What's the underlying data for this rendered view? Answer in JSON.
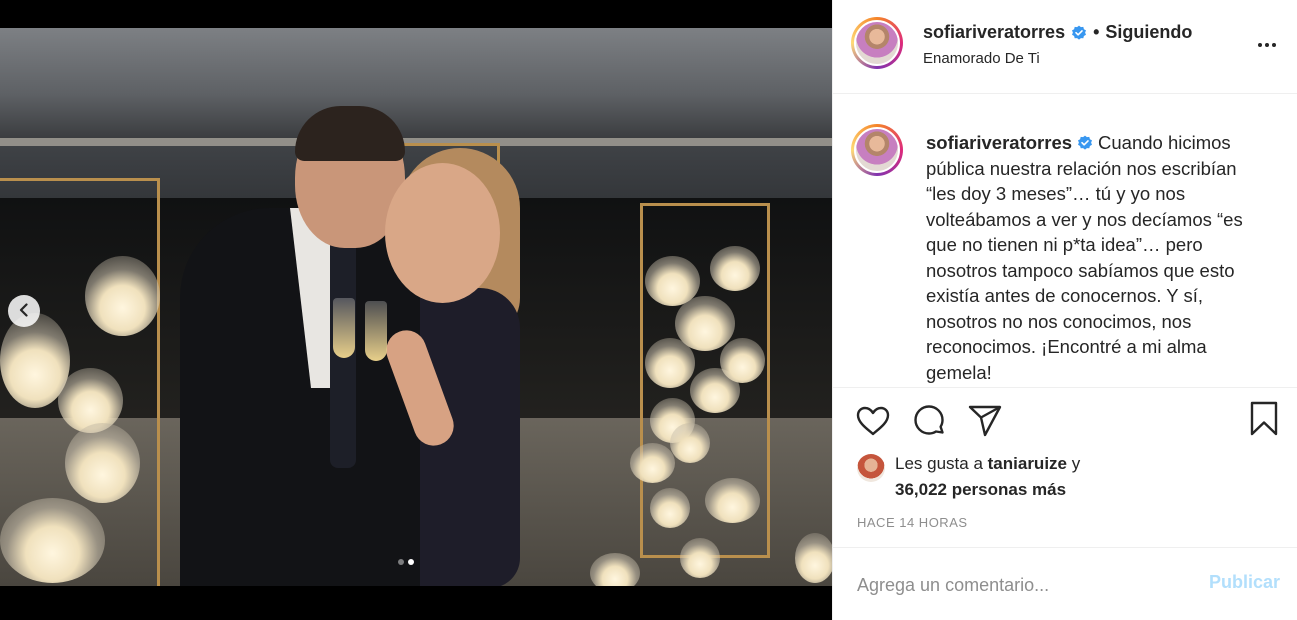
{
  "post": {
    "username": "sofiariveratorres",
    "follow_separator": "•",
    "follow_status": "Siguiendo",
    "location": "Enamorado De Ti"
  },
  "media": {
    "slide_count": 2,
    "active_slide": 2
  },
  "caption": {
    "username": "sofiariveratorres",
    "text": "Cuando hicimos pública nuestra relación nos escribían “les doy 3 meses”… tú y yo nos volteábamos a ver y nos decíamos “es que no tienen ni p*ta idea”… pero nosotros tampoco sabíamos que esto existía antes de conocernos. Y sí, nosotros no nos conocimos, nos reconocimos. ¡Encontré a mi alma gemela!"
  },
  "likes": {
    "prefix": "Les gusta a",
    "liker": "taniaruize",
    "connector": "y",
    "others": "36,022 personas más"
  },
  "timestamp": "HACE 14 HORAS",
  "comment_form": {
    "placeholder": "Agrega un comentario...",
    "post_label": "Publicar"
  },
  "icons": {
    "verified": "verified-badge-icon",
    "more": "more-options-icon",
    "like": "heart-icon",
    "comment": "comment-icon",
    "share": "paper-plane-icon",
    "save": "bookmark-icon",
    "prev": "chevron-left-icon"
  },
  "colors": {
    "verified_blue": "#3897f0",
    "post_button_disabled": "#b2dffc",
    "muted_text": "#8e8e8e"
  }
}
